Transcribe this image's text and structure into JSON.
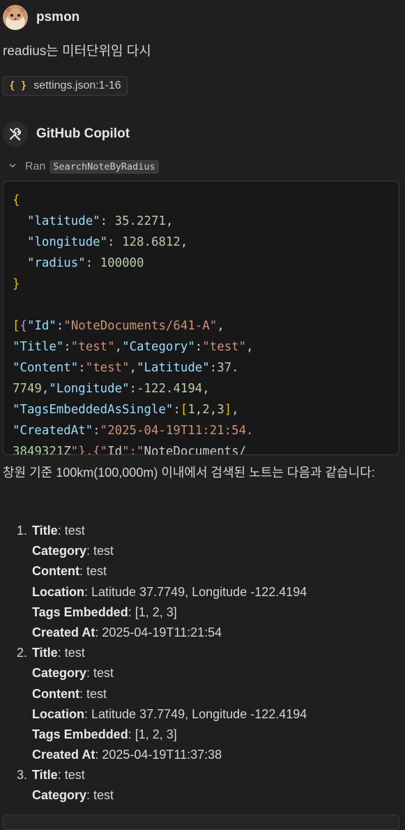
{
  "user": {
    "name": "psmon",
    "message": "readius는 미터단위임 다시",
    "attachment": {
      "icon": "json-braces-icon",
      "label": "settings.json:1-16"
    }
  },
  "assistant": {
    "name": "GitHub Copilot",
    "avatar_icon": "tools-icon",
    "ran_label": "Ran",
    "tool_name": "SearchNoteByRadius",
    "code": {
      "open_brace": "{",
      "params": [
        {
          "key": "\"latitude\"",
          "value": "35.2271",
          "trail": ","
        },
        {
          "key": "\"longitude\"",
          "value": "128.6812",
          "trail": ","
        },
        {
          "key": "\"radius\"",
          "value": "100000",
          "trail": ""
        }
      ],
      "close_brace": "}",
      "result_lines": [
        "[{\"Id\":\"NoteDocuments/641-A\",",
        "\"Title\":\"test\",\"Category\":\"test\",",
        "\"Content\":\"test\",\"Latitude\":37.",
        "7749,\"Longitude\":-122.4194,",
        "\"TagsEmbeddedAsSingle\":[1,2,3],",
        "\"CreatedAt\":\"2025-04-19T11:21:54.",
        "3849321Z\"},{\"Id\":\"NoteDocuments/"
      ]
    },
    "answer_intro": "창원 기준 100km(100,000m) 이내에서 검색된 노트는 다음과 같습니다:",
    "notes": [
      {
        "num": "1.",
        "fields": [
          {
            "label": "Title",
            "value": ": test"
          },
          {
            "label": "Category",
            "value": ": test"
          },
          {
            "label": "Content",
            "value": ": test"
          },
          {
            "label": "Location",
            "value": ": Latitude 37.7749, Longitude -122.4194"
          },
          {
            "label": "Tags Embedded",
            "value": ": [1, 2, 3]"
          },
          {
            "label": "Created At",
            "value": ": 2025-04-19T11:21:54"
          }
        ]
      },
      {
        "num": "2.",
        "fields": [
          {
            "label": "Title",
            "value": ": test"
          },
          {
            "label": "Category",
            "value": ": test"
          },
          {
            "label": "Content",
            "value": ": test"
          },
          {
            "label": "Location",
            "value": ": Latitude 37.7749, Longitude -122.4194"
          },
          {
            "label": "Tags Embedded",
            "value": ": [1, 2, 3]"
          },
          {
            "label": "Created At",
            "value": ": 2025-04-19T11:37:38"
          }
        ]
      },
      {
        "num": "3.",
        "fields": [
          {
            "label": "Title",
            "value": ": test"
          },
          {
            "label": "Category",
            "value": ": test"
          }
        ]
      }
    ]
  }
}
